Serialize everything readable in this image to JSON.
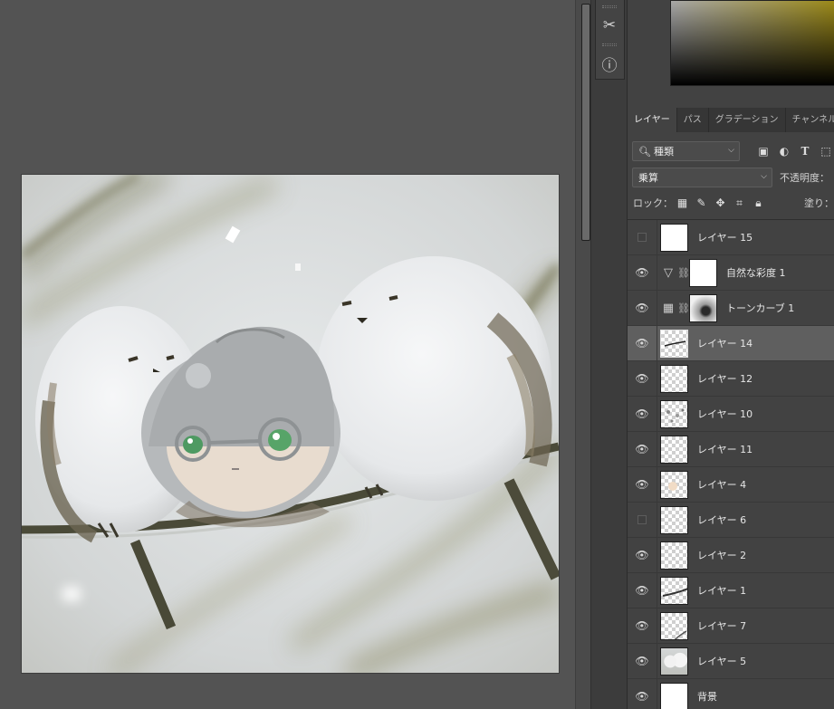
{
  "color_picker": {
    "gradient_from": "#a8a8a8",
    "gradient_to": "#9c8a1a"
  },
  "side_strip": {
    "buttons": [
      {
        "icon": "adjust-tools-icon",
        "glyph": "✂"
      },
      {
        "icon": "info-icon",
        "glyph": "ⓘ"
      }
    ]
  },
  "layers_panel": {
    "tabs": [
      {
        "label": "レイヤー",
        "active": true
      },
      {
        "label": "パス",
        "active": false
      },
      {
        "label": "グラデーション",
        "active": false
      },
      {
        "label": "チャンネル",
        "active": false
      }
    ],
    "filter": {
      "label": "種類",
      "icons": [
        "image-filter-icon",
        "adjustment-filter-icon",
        "type-filter-icon",
        "shape-filter-icon"
      ]
    },
    "blend_mode": "乗算",
    "opacity_label": "不透明度：",
    "lock_label": "ロック：",
    "lock_icons": [
      "lock-transparent-icon",
      "lock-brush-icon",
      "lock-move-icon",
      "lock-artboard-icon",
      "lock-all-icon"
    ],
    "fill_label": "塗り：",
    "layers": [
      {
        "name": "レイヤー 15",
        "visible": false,
        "thumb": "white",
        "kind": "pixel",
        "selected": false
      },
      {
        "name": "自然な彩度 1",
        "visible": true,
        "thumb": "white",
        "kind": "vibrance",
        "selected": false
      },
      {
        "name": "トーンカーブ 1",
        "visible": true,
        "thumb": "mask",
        "kind": "curves",
        "selected": false
      },
      {
        "name": "レイヤー 14",
        "visible": true,
        "thumb": "stroke",
        "kind": "pixel",
        "selected": true
      },
      {
        "name": "レイヤー 12",
        "visible": true,
        "thumb": "checker",
        "kind": "pixel",
        "selected": false
      },
      {
        "name": "レイヤー 10",
        "visible": true,
        "thumb": "speckle",
        "kind": "pixel",
        "selected": false
      },
      {
        "name": "レイヤー 11",
        "visible": true,
        "thumb": "checker",
        "kind": "pixel",
        "selected": false
      },
      {
        "name": "レイヤー 4",
        "visible": true,
        "thumb": "peach",
        "kind": "pixel",
        "selected": false
      },
      {
        "name": "レイヤー 6",
        "visible": false,
        "thumb": "checker",
        "kind": "pixel",
        "selected": false
      },
      {
        "name": "レイヤー 2",
        "visible": true,
        "thumb": "checker",
        "kind": "pixel",
        "selected": false
      },
      {
        "name": "レイヤー 1",
        "visible": true,
        "thumb": "branch",
        "kind": "pixel",
        "selected": false
      },
      {
        "name": "レイヤー 7",
        "visible": true,
        "thumb": "checker-branch",
        "kind": "pixel",
        "selected": false
      },
      {
        "name": "レイヤー 5",
        "visible": true,
        "thumb": "painting",
        "kind": "pixel",
        "selected": false
      },
      {
        "name": "背景",
        "visible": true,
        "thumb": "white",
        "kind": "background",
        "selected": false
      }
    ]
  }
}
